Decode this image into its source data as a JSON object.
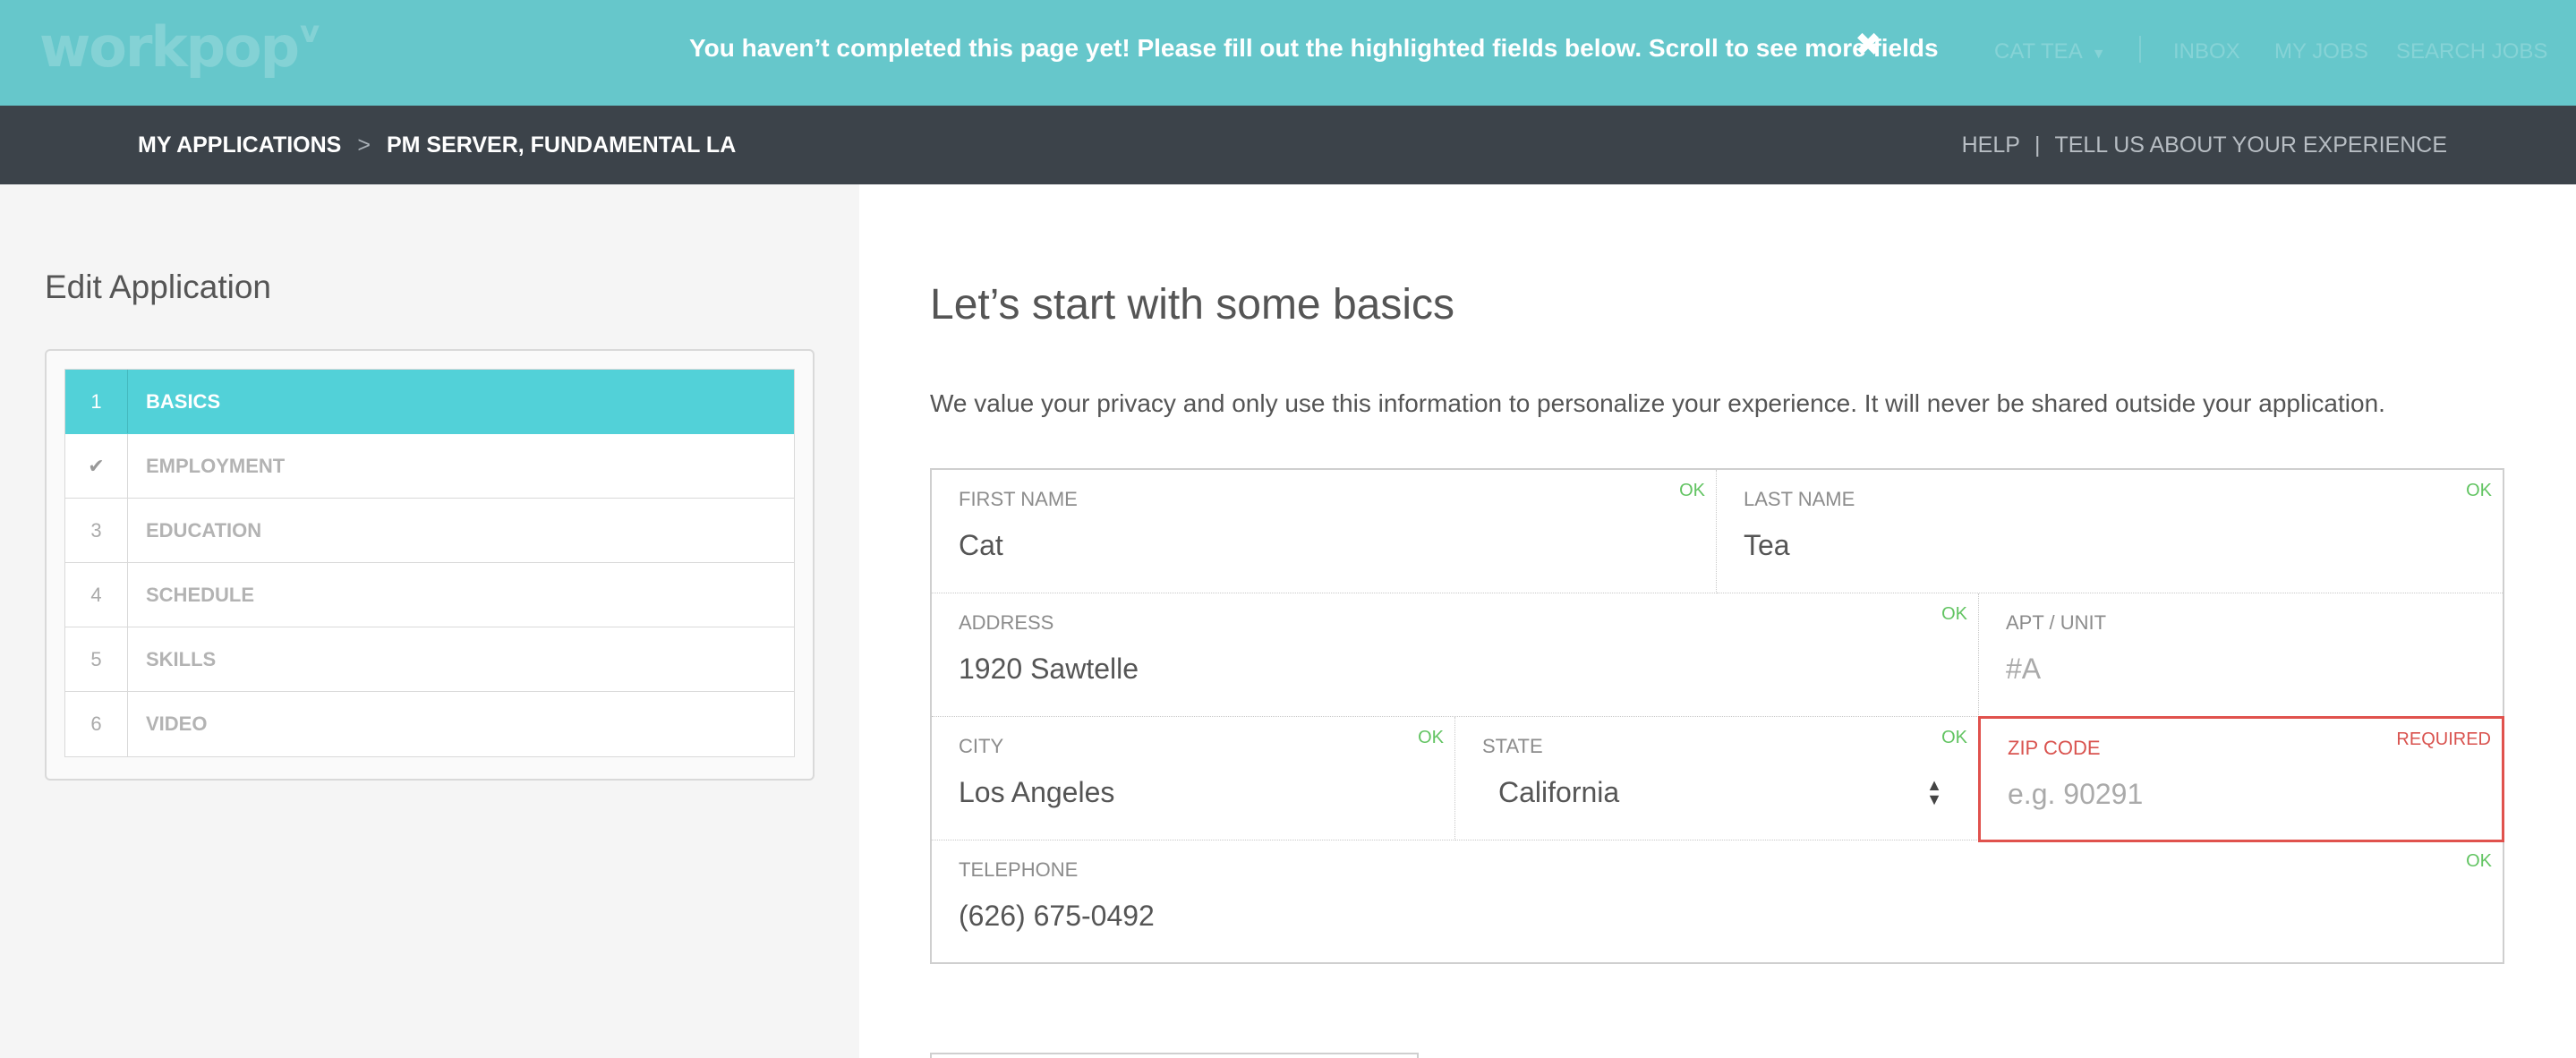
{
  "app": {
    "logo_text": "workpop",
    "logo_mark": "v"
  },
  "banner": {
    "message": "You haven’t completed this page yet! Please fill out the highlighted fields below. Scroll to see more fields",
    "close_icon": "✖"
  },
  "topnav": {
    "user": "CAT TEA",
    "inbox": "INBOX",
    "my_jobs": "MY JOBS",
    "search_jobs": "SEARCH JOBS"
  },
  "breadcrumb": {
    "root": "MY APPLICATIONS",
    "separator": ">",
    "current": "PM SERVER,  FUNDAMENTAL LA"
  },
  "subnav": {
    "help": "HELP",
    "separator": "|",
    "feedback": "TELL US ABOUT YOUR EXPERIENCE"
  },
  "sidebar": {
    "title": "Edit Application",
    "steps": [
      {
        "num": "1",
        "label": "BASICS",
        "active": true
      },
      {
        "num": "✔",
        "label": "EMPLOYMENT",
        "active": false
      },
      {
        "num": "3",
        "label": "EDUCATION",
        "active": false
      },
      {
        "num": "4",
        "label": "SCHEDULE",
        "active": false
      },
      {
        "num": "5",
        "label": "SKILLS",
        "active": false
      },
      {
        "num": "6",
        "label": "VIDEO",
        "active": false
      }
    ]
  },
  "main": {
    "title": "Let’s start with some basics",
    "privacy_note": "We value your privacy and only use this information to personalize your experience. It will never be shared outside your application."
  },
  "form": {
    "first_name": {
      "label": "FIRST NAME",
      "value": "Cat",
      "status": "OK"
    },
    "last_name": {
      "label": "LAST NAME",
      "value": "Tea",
      "status": "OK"
    },
    "address": {
      "label": "ADDRESS",
      "value": "1920 Sawtelle",
      "status": "OK"
    },
    "apt": {
      "label": "APT / UNIT",
      "placeholder": "#A"
    },
    "city": {
      "label": "CITY",
      "value": "Los Angeles",
      "status": "OK"
    },
    "state": {
      "label": "STATE",
      "value": "California",
      "status": "OK"
    },
    "zip": {
      "label": "ZIP CODE",
      "placeholder": "e.g. 90291",
      "status": "REQUIRED"
    },
    "telephone": {
      "label": "TELEPHONE",
      "value": "(626) 675-0492",
      "status": "OK"
    }
  },
  "colors": {
    "banner_bg": "#66c7cb",
    "subbar_bg": "#3c434a",
    "active_step": "#52d1d8",
    "ok_green": "#62c462",
    "error_red": "#e0524d"
  }
}
